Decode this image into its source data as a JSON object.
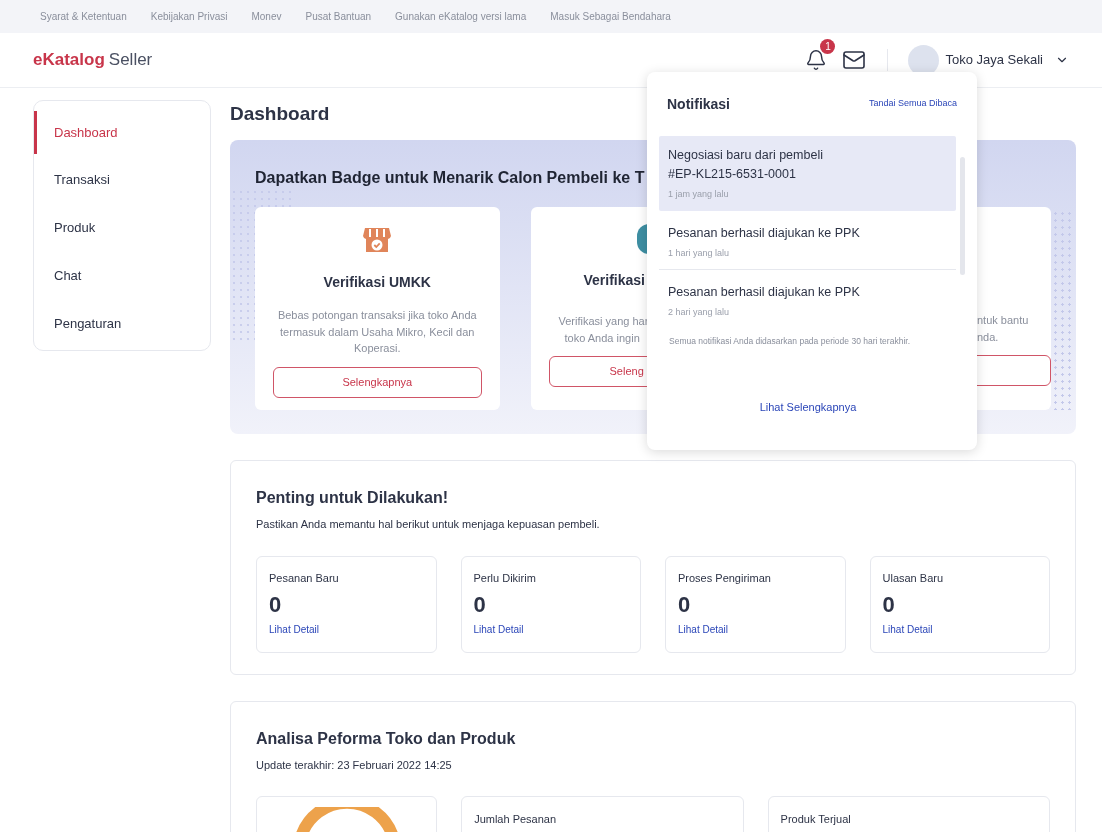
{
  "top_links": [
    "Syarat & Ketentuan",
    "Kebijakan Privasi",
    "Monev",
    "Pusat Bantuan",
    "Gunakan eKatalog versi lama",
    "Masuk Sebagai Bendahara"
  ],
  "header": {
    "logo_mark": "e",
    "logo_brand": "Katalog",
    "logo_suffix": "Seller",
    "notification_count": "1",
    "user_name": "Toko Jaya Sekali"
  },
  "sidebar": {
    "items": [
      {
        "label": "Dashboard",
        "selected": true
      },
      {
        "label": "Transaksi",
        "selected": false
      },
      {
        "label": "Produk",
        "selected": false
      },
      {
        "label": "Chat",
        "selected": false
      },
      {
        "label": "Pengaturan",
        "selected": false
      }
    ]
  },
  "page_title": "Dashboard",
  "badge_banner": {
    "title": "Dapatkan Badge untuk Menarik Calon Pembeli ke T",
    "cards": [
      {
        "kind": "full",
        "title": "Verifikasi UMKK",
        "description": "Bebas potongan transaksi jika toko Anda termasuk dalam Usaha Mikro, Kecil dan Koperasi.",
        "button": "Selengkapnya"
      },
      {
        "kind": "left",
        "title": "Verifikasi",
        "description_lines": [
          "Verifikasi yang har",
          "toko Anda ingin"
        ],
        "button": "Seleng"
      },
      {
        "kind": "right",
        "description_lines": [
          "ntuk bantu",
          "nda."
        ]
      }
    ]
  },
  "todo": {
    "title": "Penting untuk Dilakukan!",
    "subtitle": "Pastikan Anda memantu hal berikut untuk menjaga kepuasan pembeli.",
    "stats": [
      {
        "label": "Pesanan Baru",
        "value": "0",
        "link": "Lihat Detail"
      },
      {
        "label": "Perlu Dikirim",
        "value": "0",
        "link": "Lihat Detail"
      },
      {
        "label": "Proses Pengiriman",
        "value": "0",
        "link": "Lihat Detail"
      },
      {
        "label": "Ulasan Baru",
        "value": "0",
        "link": "Lihat Detail"
      }
    ]
  },
  "analysis": {
    "title": "Analisa Peforma Toko dan Produk",
    "updated": "Update terakhir: 23 Februari 2022 14:25",
    "cards": [
      "Jumlah Pesanan",
      "Produk Terjual"
    ]
  },
  "notifications": {
    "title": "Notifikasi",
    "mark_all": "Tandai Semua Dibaca",
    "items": [
      {
        "lines": [
          "Negosiasi baru dari pembeli",
          "#EP-KL215-6531-0001"
        ],
        "time": "1 jam yang lalu",
        "unread": true
      },
      {
        "lines": [
          "Pesanan berhasil diajukan ke PPK"
        ],
        "time": "1 hari yang lalu",
        "unread": false
      },
      {
        "lines": [
          "Pesanan berhasil diajukan ke PPK"
        ],
        "time": "2 hari yang lalu",
        "unread": false
      }
    ],
    "footnote": "Semua notifikasi Anda didasarkan pada periode 30 hari terakhir.",
    "see_more": "Lihat Selengkapnya"
  }
}
